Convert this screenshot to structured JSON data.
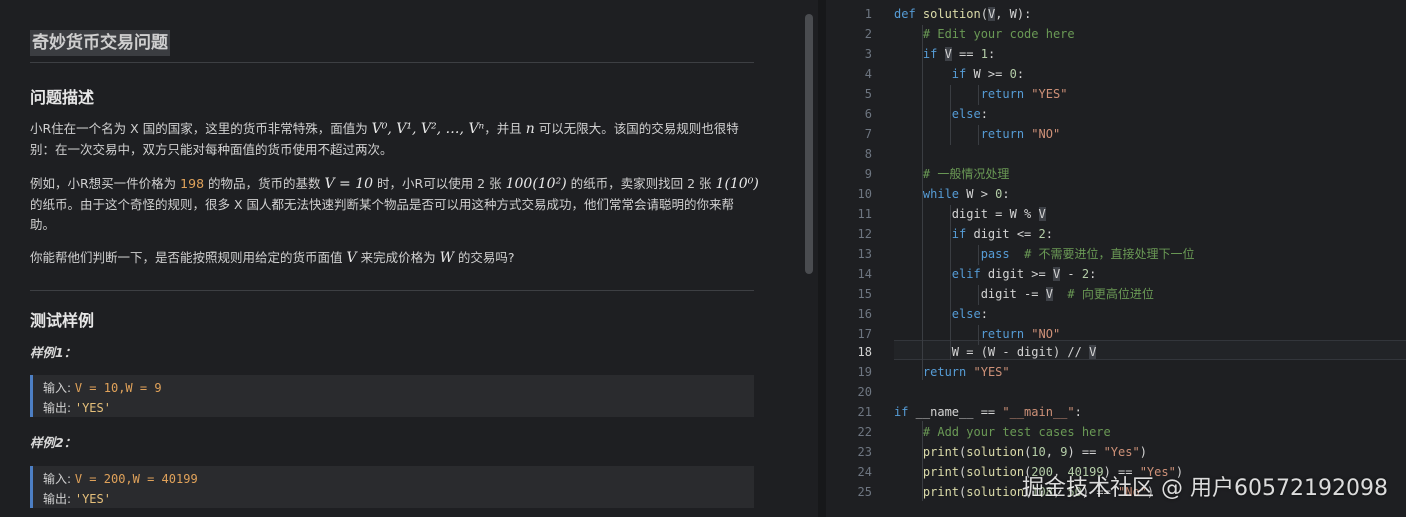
{
  "problem": {
    "title": "奇妙货币交易问题",
    "desc_heading": "问题描述",
    "p1_a": "小R住在一个名为 X 国的国家，这里的货币非常特殊，面值为 ",
    "p1_math": "V⁰, V¹, V², …, Vⁿ",
    "p1_b": "，并且 ",
    "p1_n": "n",
    "p1_c": " 可以无限大。该国的交易规则也很特",
    "p1_line2": "别：在一次交易中，双方只能对每种面值的货币使用不超过两次。",
    "p2_a": "例如，小R想买一件价格为 ",
    "p2_price": "198",
    "p2_b": " 的物品，货币的基数 ",
    "p2_math1": "V = 10",
    "p2_c": " 时，小R可以使用 2 张 ",
    "p2_math2": "100(10²)",
    "p2_d": " 的纸币，卖家则找回 2 张 ",
    "p2_math3": "1(10⁰)",
    "p2_line2": "的纸币。由于这个奇怪的规则，很多 X 国人都无法快速判断某个物品是否可以用这种方式交易成功，他们常常会请聪明的你来帮",
    "p2_line3": "助。",
    "p3_a": "你能帮他们判断一下，是否能按照规则用给定的货币面值 ",
    "p3_v": "V",
    "p3_b": " 来完成价格为 ",
    "p3_w": "W",
    "p3_c": " 的交易吗?",
    "samples_heading": "测试样例",
    "sample1_title": "样例1：",
    "sample1_in_label": "输入: ",
    "sample1_in": "V = 10,W = 9",
    "sample1_out_label": "输出: ",
    "sample1_out": "'YES'",
    "sample2_title": "样例2：",
    "sample2_in_label": "输入: ",
    "sample2_in": "V = 200,W = 40199",
    "sample2_out_label": "输出: ",
    "sample2_out": "'YES'"
  },
  "editor": {
    "active_line": 18,
    "line_numbers": [
      "1",
      "2",
      "3",
      "4",
      "5",
      "6",
      "7",
      "8",
      "9",
      "10",
      "11",
      "12",
      "13",
      "14",
      "15",
      "16",
      "17",
      "18",
      "19",
      "20",
      "21",
      "22",
      "23",
      "24",
      "25"
    ]
  },
  "watermark": "掘金技术社区 @ 用户60572192098"
}
